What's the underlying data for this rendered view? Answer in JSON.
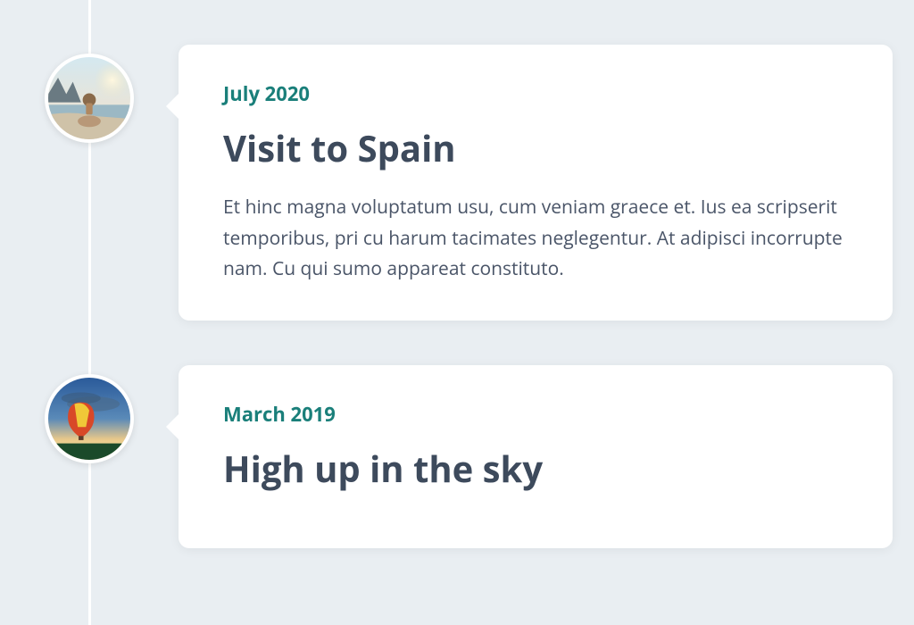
{
  "timeline": {
    "items": [
      {
        "date": "July 2020",
        "title": "Visit to Spain",
        "body": "Et hinc magna voluptatum usu, cum veniam graece et. Ius ea scripserit temporibus, pri cu harum tacimates neglegentur. At adipisci incorrupte nam. Cu qui sumo appareat constituto.",
        "image_alt": "person-sitting-beach-rocks"
      },
      {
        "date": "March 2019",
        "title": "High up in the sky",
        "body": "",
        "image_alt": "hot-air-balloon-sunset"
      }
    ]
  },
  "colors": {
    "accent": "#1a7f7a",
    "heading": "#3d4a5c",
    "body": "#4a5568",
    "background": "#e9eef2",
    "card": "#ffffff"
  }
}
